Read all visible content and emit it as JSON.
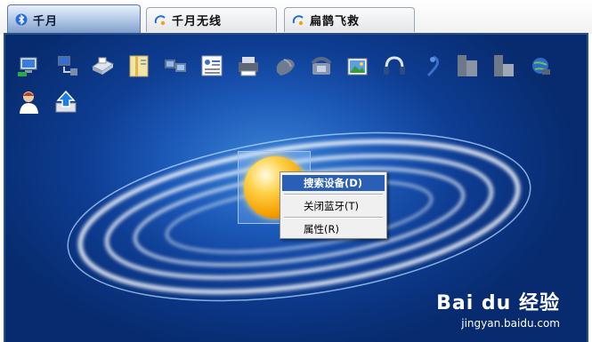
{
  "tabs": [
    {
      "label": "千月",
      "icon": "bluetooth-icon",
      "active": true
    },
    {
      "label": "千月无线",
      "icon": "wireless-icon",
      "active": false
    },
    {
      "label": "扁鹊飞救",
      "icon": "rescue-icon",
      "active": false
    }
  ],
  "toolbar_icons": [
    "network-computer-icon",
    "lan-access-icon",
    "printer-icon",
    "file-folder-icon",
    "dialup-network-icon",
    "business-card-icon",
    "fax-printer-icon",
    "mouse-icon",
    "telephone-icon",
    "photo-icon",
    "headphones-icon",
    "headset-icon",
    "serial-port-icon",
    "modem-icon",
    "network-globe-icon",
    "user-icon",
    "transfer-upload-icon"
  ],
  "context_menu": {
    "items": [
      {
        "label": "搜索设备(D)",
        "highlighted": true
      },
      {
        "label": "关闭蓝牙(T)",
        "highlighted": false
      },
      {
        "label": "属性(R)",
        "highlighted": false
      }
    ]
  },
  "watermark": {
    "logo": "Bai du 经验",
    "url": "jingyan.baidu.com"
  },
  "colors": {
    "panel_bg": "#1c59b8",
    "menu_highlight": "#2a5fb8"
  }
}
